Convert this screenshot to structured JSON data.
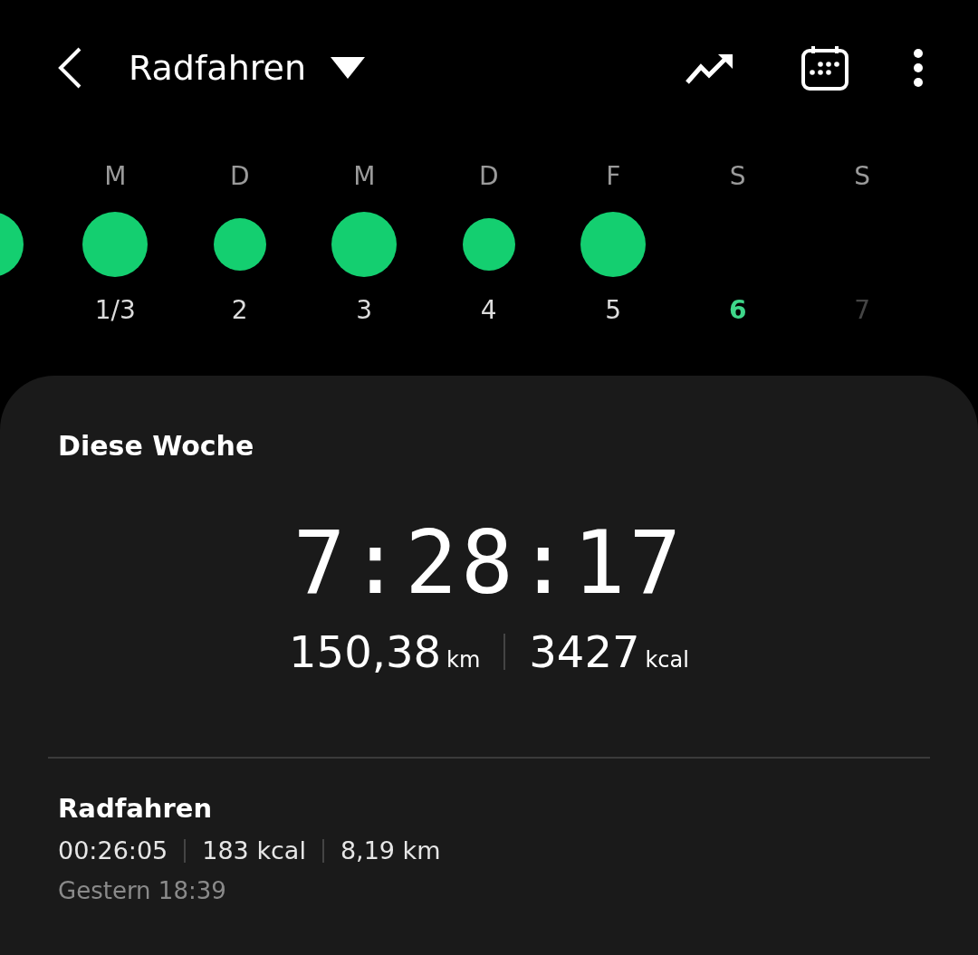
{
  "header": {
    "title": "Radfahren"
  },
  "days": [
    {
      "active": true,
      "large": true
    },
    {
      "weekday": "M",
      "date": "1/3",
      "active": true,
      "large": true,
      "today": false,
      "upcoming": false
    },
    {
      "weekday": "D",
      "date": "2",
      "active": true,
      "large": false,
      "today": false,
      "upcoming": false
    },
    {
      "weekday": "M",
      "date": "3",
      "active": true,
      "large": true,
      "today": false,
      "upcoming": false
    },
    {
      "weekday": "D",
      "date": "4",
      "active": true,
      "large": false,
      "today": false,
      "upcoming": false
    },
    {
      "weekday": "F",
      "date": "5",
      "active": true,
      "large": true,
      "today": false,
      "upcoming": false
    },
    {
      "weekday": "S",
      "date": "6",
      "active": false,
      "today": true,
      "upcoming": false
    },
    {
      "weekday": "S",
      "date": "7",
      "active": false,
      "today": false,
      "upcoming": true
    }
  ],
  "summary": {
    "title": "Diese Woche",
    "duration": "7:28:17",
    "distance": "150,38",
    "distance_unit": "km",
    "energy": "3427",
    "energy_unit": "kcal"
  },
  "activities": [
    {
      "title": "Radfahren",
      "stats": [
        "00:26:05",
        "183 kcal",
        "8,19 km"
      ],
      "time": "Gestern 18:39"
    }
  ]
}
